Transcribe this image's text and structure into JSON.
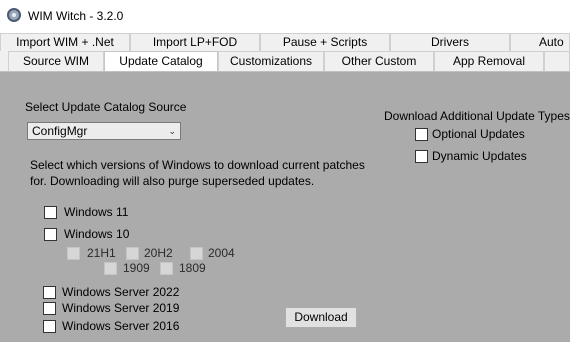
{
  "window": {
    "title": "WIM Witch - 3.2.0",
    "icon": "app-disc-icon"
  },
  "tabs_row1": [
    {
      "label": "Import WIM + .Net"
    },
    {
      "label": "Import LP+FOD"
    },
    {
      "label": "Pause + Scripts"
    },
    {
      "label": "Drivers"
    },
    {
      "label": "Auto"
    }
  ],
  "tabs_row2": [
    {
      "label": "Source WIM"
    },
    {
      "label": "Update Catalog",
      "active": true
    },
    {
      "label": "Customizations"
    },
    {
      "label": "Other Custom"
    },
    {
      "label": "App Removal"
    },
    {
      "label": ""
    }
  ],
  "catalog": {
    "source_label": "Select Update Catalog Source",
    "source_selected": "ConfigMgr",
    "description": "Select which versions of Windows to download current patches for. Downloading will also purge superseded updates.",
    "windows11": "Windows 11",
    "windows10": "Windows 10",
    "win10_versions": [
      "21H1",
      "20H2",
      "2004",
      "1909",
      "1809"
    ],
    "server2022": "Windows Server 2022",
    "server2019": "Windows Server 2019",
    "server2016": "Windows Server 2016",
    "download_button": "Download"
  },
  "additional": {
    "title": "Download Additional Update Types",
    "optional": "Optional Updates",
    "dynamic": "Dynamic Updates"
  }
}
